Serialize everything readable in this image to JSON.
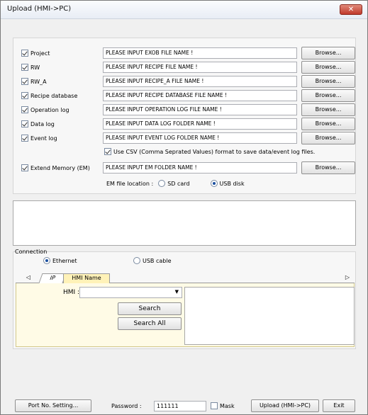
{
  "window": {
    "title": "Upload (HMI->PC)",
    "close_glyph": "✕"
  },
  "rows": [
    {
      "label": "Project",
      "value": "PLEASE INPUT EXOB FILE NAME !",
      "checked": true,
      "browse": "Browse..."
    },
    {
      "label": "RW",
      "value": "PLEASE INPUT RECIPE FILE NAME !",
      "checked": true,
      "browse": "Browse..."
    },
    {
      "label": "RW_A",
      "value": "PLEASE INPUT RECIPE_A FILE NAME !",
      "checked": true,
      "browse": "Browse..."
    },
    {
      "label": "Recipe database",
      "value": "PLEASE INPUT RECIPE DATABASE FILE NAME !",
      "checked": true,
      "browse": "Browse..."
    },
    {
      "label": "Operation log",
      "value": "PLEASE INPUT OPERATION LOG FILE NAME !",
      "checked": true,
      "browse": "Browse..."
    },
    {
      "label": "Data log",
      "value": "PLEASE INPUT DATA LOG FOLDER NAME !",
      "checked": true,
      "browse": "Browse..."
    },
    {
      "label": "Event log",
      "value": "PLEASE INPUT EVENT LOG FOLDER NAME !",
      "checked": true,
      "browse": "Browse..."
    }
  ],
  "csv_option": {
    "label": "Use CSV (Comma Seprated Values) format to save data/event log files.",
    "checked": true
  },
  "em_row": {
    "label": "Extend Memory (EM)",
    "value": "PLEASE INPUT EM FOLDER NAME !",
    "checked": true,
    "browse": "Browse..."
  },
  "em_location": {
    "label": "EM file location :",
    "options": [
      "SD card",
      "USB disk"
    ],
    "selected": "USB disk"
  },
  "connection": {
    "label": "Connection",
    "options": [
      "Ethernet",
      "USB cable"
    ],
    "selected": "Ethernet",
    "tabs": [
      "IP",
      "HMI Name"
    ],
    "active_tab": "HMI Name",
    "nav_left": "◁",
    "nav_right": "▷",
    "hmi_label": "HMI :",
    "hmi_value": "",
    "search_label": "Search",
    "search_all_label": "Search All"
  },
  "footer": {
    "port_label": "Port No. Setting...",
    "password_label": "Password :",
    "password_value": "111111",
    "mask_label": "Mask",
    "mask_checked": false,
    "upload_label": "Upload (HMI->PC)",
    "exit_label": "Exit"
  },
  "icons": {
    "close": "close-icon",
    "combo_arrow": "chevron-down-icon"
  }
}
